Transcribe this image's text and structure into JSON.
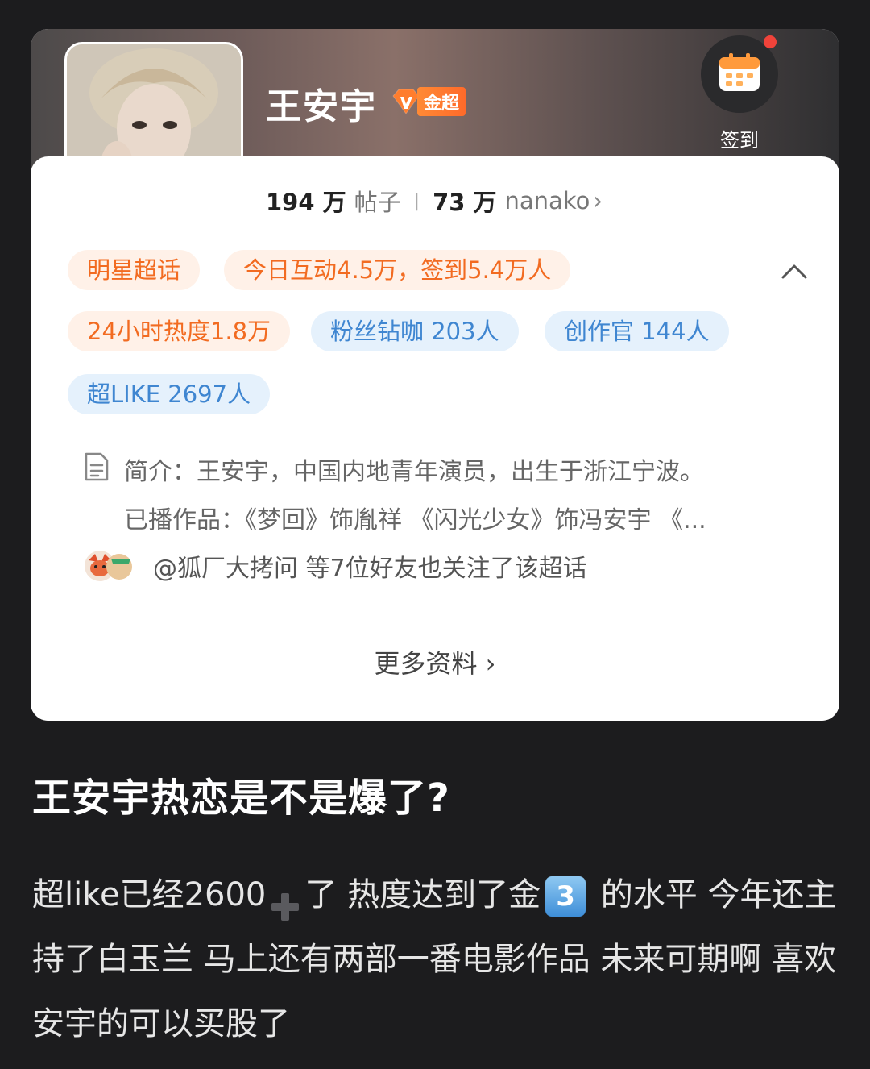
{
  "header": {
    "name": "王安宇",
    "badge_label": "金超",
    "checkin_label": "签到"
  },
  "stats": {
    "posts_num": "194 万",
    "posts_label": "帖子",
    "fans_num": "73 万",
    "fans_label": "nanako",
    "chevron": "›"
  },
  "tags": {
    "star": "明星超话",
    "today": "今日互动4.5万，签到5.4万人",
    "heat": "24小时热度1.8万",
    "diamond": "粉丝钻咖 203人",
    "creator": "创作官 144人",
    "superlike": "超LIKE 2697人"
  },
  "intro": {
    "line1": "简介：王安宇，中国内地青年演员，出生于浙江宁波。",
    "line2": "已播作品：《梦回》饰胤祥 《闪光少女》饰冯安宇 《..."
  },
  "friends": {
    "text": "@狐厂大拷问 等7位好友也关注了该超话"
  },
  "more": {
    "label": "更多资料 ›"
  },
  "post": {
    "title": "王安宇热恋是不是爆了?",
    "body_part1": "超like已经2600",
    "body_part2": "了 热度达到了金",
    "emoji_number": "3",
    "body_part3": " 的水平 今年还主持了白玉兰 马上还有两部一番电影作品 未来可期啊 喜欢安宇的可以买股了"
  },
  "icons": {
    "badge": "diamond-v3-icon",
    "checkin": "calendar-icon",
    "collapse": "chevron-up-icon",
    "intro": "document-icon",
    "plus": "heavy-plus-emoji",
    "number": "keycap-3-emoji"
  },
  "colors": {
    "accent_orange": "#f26b21",
    "accent_blue": "#3f86d1",
    "background": "#1c1c1e"
  }
}
